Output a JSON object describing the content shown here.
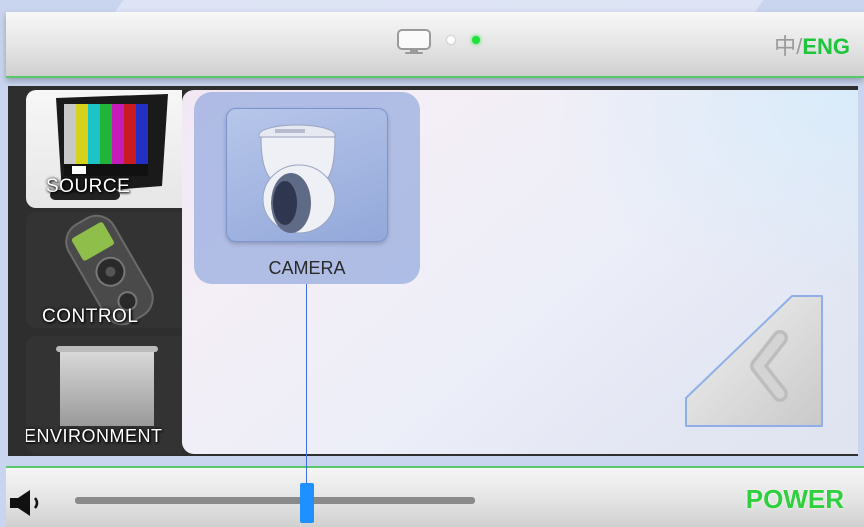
{
  "header": {
    "lang_zh": "中",
    "lang_sep": "/",
    "lang_eng": "ENG",
    "page_indicator": {
      "pages": 2,
      "active": 2
    }
  },
  "sidebar": {
    "items": [
      {
        "label": "SOURCE",
        "selected": true
      },
      {
        "label": "CONTROL",
        "selected": false
      },
      {
        "label": "ENVIRONMENT",
        "selected": false
      }
    ]
  },
  "main": {
    "tiles": [
      {
        "label": "CAMERA",
        "icon": "ptz-camera-icon",
        "selected": true
      }
    ],
    "back_icon": "chevron-left-icon"
  },
  "footer": {
    "volume_level": 0.58,
    "volume_icon": "speaker-icon",
    "power_label": "POWER"
  },
  "colors": {
    "accent_green": "#1ec43a",
    "slider_thumb": "#1e90ff",
    "tile_highlight": "#7896d7"
  }
}
